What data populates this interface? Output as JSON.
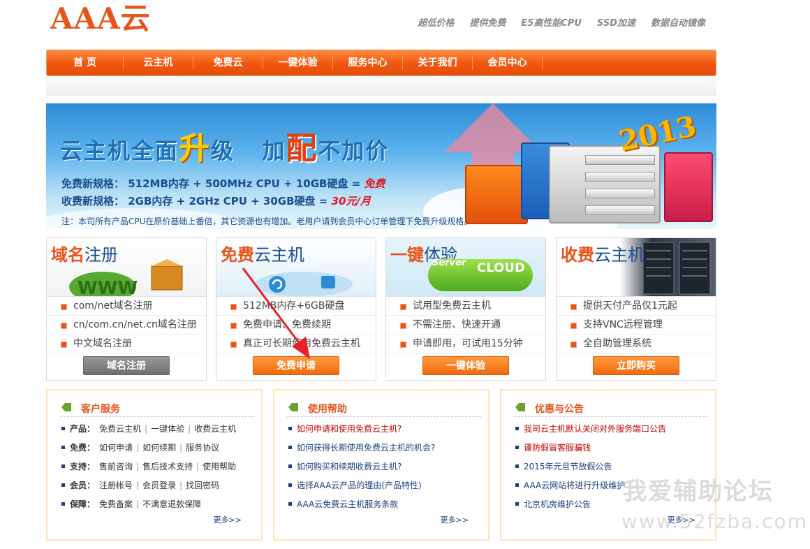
{
  "logo": {
    "text": "AAA云"
  },
  "slogans": [
    "超低价格",
    "提供免费",
    "E5高性能CPU",
    "SSD加速",
    "数据自动镜像"
  ],
  "nav": [
    "首 页",
    "云主机",
    "免费云",
    "一键体验",
    "服务中心",
    "关于我们",
    "会员中心"
  ],
  "banner": {
    "title_a": "云主机全面",
    "title_b": "升",
    "title_c": "级",
    "title_d": "加",
    "title_e": "配",
    "title_f": "不加价",
    "free_label": "免费新规格：",
    "free_specs": "512MB内存 + 500MHz CPU + 10GB硬盘 =",
    "free_price": "免费",
    "paid_label": "收费新规格：",
    "paid_specs": "2GB内存    + 2GHz CPU    + 30GB硬盘 =",
    "paid_price": "30元/月",
    "note": "注：本司所有产品CPU在原价基础上番倍，其它资源也有增加。老用户请到会员中心订单管理下免费升级规格。",
    "year": "2013"
  },
  "products": [
    {
      "hl": "域名",
      "nm": "注册",
      "items": [
        "com/net域名注册",
        "cn/com.cn/net.cn域名注册",
        "中文域名注册"
      ],
      "button": "域名注册",
      "btn_style": "gray"
    },
    {
      "hl": "免费",
      "nm": "云主机",
      "items": [
        "512MB内存+6GB硬盘",
        "免费申请、免费续期",
        "真正可长期使用免费云主机"
      ],
      "button": "免费申请",
      "btn_style": "orange"
    },
    {
      "hl": "一键",
      "nm": "体验",
      "items": [
        "试用型免费云主机",
        "不需注册、快速开通",
        "申请即用，可试用15分钟"
      ],
      "button": "一键体验",
      "btn_style": "orange",
      "cloud_label": "CLOUD",
      "server_label": "Server"
    },
    {
      "hl": "收费",
      "nm": "云主机",
      "items": [
        "提供天付产品仅1元起",
        "支持VNC远程管理",
        "全自助管理系统"
      ],
      "button": "立即购买",
      "btn_style": "orange"
    }
  ],
  "info": [
    {
      "title": "客户服务",
      "rows": [
        {
          "k": "产品：",
          "links": [
            "免费云主机",
            "一键体验",
            "收费云主机"
          ]
        },
        {
          "k": "免费：",
          "links": [
            "如何申请",
            "如何续期",
            "服务协议"
          ]
        },
        {
          "k": "支持：",
          "links": [
            "售前咨询",
            "售后技术支持",
            "使用帮助"
          ]
        },
        {
          "k": "会员：",
          "links": [
            "注册帐号",
            "会员登录",
            "找回密码"
          ]
        },
        {
          "k": "保障：",
          "links": [
            "免费备案",
            "不满意退款保障"
          ]
        }
      ],
      "more": "更多>>"
    },
    {
      "title": "使用帮助",
      "items": [
        "如何申请和使用免费云主机?",
        "如何获得长期使用免费云主机的机会?",
        "如何购买和续期收费云主机?",
        "选择AAA云产品的理由(产品特性)",
        "AAA云免费云主机服务条款"
      ],
      "more": "更多>>"
    },
    {
      "title": "优惠与公告",
      "items": [
        "我司云主机默认关闭对外服务端口公告",
        "谨防假冒客服骗钱",
        "2015年元旦节放假公告",
        "AAA云网站将进行升级维护",
        "北京机房维护公告"
      ],
      "more": "更多>>"
    }
  ],
  "watermark": {
    "line1": "我爱辅助论坛",
    "line2": "www.52fzba.com"
  },
  "colors": {
    "accent": "#e8531a",
    "nav": "#f0560f",
    "link": "#1a3f7f",
    "notice_red": "#c40000"
  }
}
